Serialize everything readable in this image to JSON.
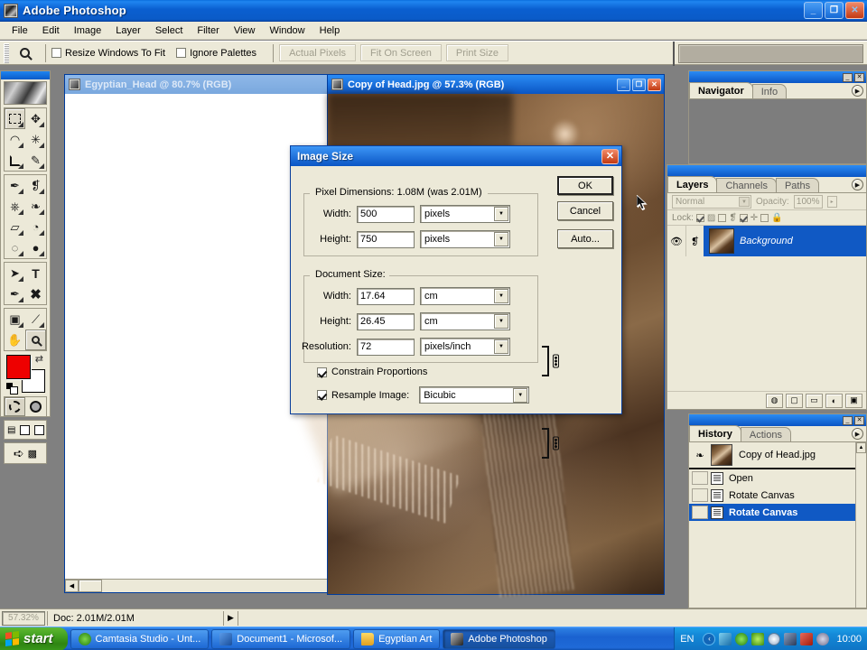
{
  "window": {
    "title": "Adobe Photoshop",
    "minimize_label": "_",
    "restore_label": "❐",
    "close_label": "✕"
  },
  "menubar": {
    "items": [
      {
        "label": "File"
      },
      {
        "label": "Edit"
      },
      {
        "label": "Image"
      },
      {
        "label": "Layer"
      },
      {
        "label": "Select"
      },
      {
        "label": "Filter"
      },
      {
        "label": "View"
      },
      {
        "label": "Window"
      },
      {
        "label": "Help"
      }
    ]
  },
  "options_bar": {
    "active_tool_icon": "zoom-magnifier-icon",
    "checkboxes": [
      {
        "label": "Resize Windows To Fit",
        "checked": false
      },
      {
        "label": "Ignore Palettes",
        "checked": false
      }
    ],
    "buttons": [
      {
        "label": "Actual Pixels",
        "disabled": true
      },
      {
        "label": "Fit On Screen",
        "disabled": true
      },
      {
        "label": "Print Size",
        "disabled": true
      }
    ]
  },
  "toolbox": {
    "tools": [
      {
        "name": "rectangular-marquee-tool",
        "glyph": ""
      },
      {
        "name": "move-tool",
        "glyph": "➤"
      },
      {
        "name": "lasso-tool",
        "glyph": "◠"
      },
      {
        "name": "magic-wand-tool",
        "glyph": "✳"
      },
      {
        "name": "crop-tool",
        "glyph": ""
      },
      {
        "name": "slice-tool",
        "glyph": "✎"
      },
      {
        "name": "healing-brush-tool",
        "glyph": "✒"
      },
      {
        "name": "brush-tool",
        "glyph": "🖌"
      },
      {
        "name": "clone-stamp-tool",
        "glyph": "⎈"
      },
      {
        "name": "history-brush-tool",
        "glyph": "✍"
      },
      {
        "name": "eraser-tool",
        "glyph": "▱"
      },
      {
        "name": "paint-bucket-tool",
        "glyph": "◔"
      },
      {
        "name": "blur-tool",
        "glyph": "◍"
      },
      {
        "name": "dodge-tool",
        "glyph": "●"
      },
      {
        "name": "path-selection-tool",
        "glyph": "➤"
      },
      {
        "name": "type-tool",
        "glyph": "T"
      },
      {
        "name": "pen-tool",
        "glyph": "✒"
      },
      {
        "name": "custom-shape-tool",
        "glyph": "✖"
      },
      {
        "name": "notes-tool",
        "glyph": "▣"
      },
      {
        "name": "eyedropper-tool",
        "glyph": "⟋"
      },
      {
        "name": "hand-tool",
        "glyph": "✋"
      },
      {
        "name": "zoom-tool",
        "glyph": "🔍"
      }
    ],
    "foreground_color": "#EE0000",
    "background_color": "#FFFFFF",
    "mode_buttons": [
      "standard-mask-mode",
      "quick-mask-mode"
    ],
    "screen_modes": [
      "standard-screen-mode",
      "full-screen-with-menubar",
      "full-screen-mode"
    ],
    "jump_to_label": "jump-to-imageready"
  },
  "documents": [
    {
      "title": "Egyptian_Head @ 80.7% (RGB)",
      "active": false,
      "canvas_background": "#FFFFFF"
    },
    {
      "title": "Copy of Head.jpg @ 57.3% (RGB)",
      "active": true,
      "minimize_label": "_",
      "maximize_label": "❐",
      "close_label": "✕"
    }
  ],
  "palettes": {
    "navigator": {
      "tabs": [
        {
          "label": "Navigator",
          "active": true
        },
        {
          "label": "Info",
          "active": false
        }
      ],
      "minimize_label": "_",
      "close_label": "✕",
      "menu_label": "▶"
    },
    "layers": {
      "tabs": [
        {
          "label": "Layers",
          "active": true
        },
        {
          "label": "Channels",
          "active": false
        },
        {
          "label": "Paths",
          "active": false
        }
      ],
      "blend_mode": "Normal",
      "opacity_label": "Opacity:",
      "opacity_value": "100%",
      "lock_label": "Lock:",
      "lock_items": [
        {
          "name": "lock-transparent-pixels",
          "checked": true,
          "glyph": "▨"
        },
        {
          "name": "lock-image-pixels",
          "checked": false,
          "glyph": "🖌"
        },
        {
          "name": "lock-position",
          "checked": true,
          "glyph": "✛"
        },
        {
          "name": "lock-all",
          "checked": false,
          "glyph": "🔒"
        }
      ],
      "layer_items": [
        {
          "name": "Background",
          "visible": true,
          "locked": true,
          "selected": true
        }
      ],
      "bottom_buttons": [
        {
          "name": "layer-style-button",
          "glyph": "◍"
        },
        {
          "name": "layer-mask-button",
          "glyph": "▢"
        },
        {
          "name": "new-group-button",
          "glyph": "▭"
        },
        {
          "name": "adjustment-layer-button",
          "glyph": "◐"
        },
        {
          "name": "new-layer-button",
          "glyph": "▣"
        },
        {
          "name": "delete-layer-button",
          "glyph": "🗑"
        }
      ],
      "menu_label": "▶"
    },
    "history": {
      "tabs": [
        {
          "label": "History",
          "active": true
        },
        {
          "label": "Actions",
          "active": false
        }
      ],
      "snapshot": "Copy of Head.jpg",
      "states": [
        {
          "label": "Open",
          "selected": false
        },
        {
          "label": "Rotate Canvas",
          "selected": false
        },
        {
          "label": "Rotate Canvas",
          "selected": true
        }
      ],
      "menu_label": "▶",
      "minimize_label": "_",
      "close_label": "✕"
    }
  },
  "dialog": {
    "title": "Image Size",
    "close_label": "✕",
    "pixel_dimensions": {
      "legend": "Pixel Dimensions:  1.08M (was 2.01M)",
      "size_current": "1.08M",
      "size_previous": "2.01M",
      "width_label": "Width:",
      "width_value": "500",
      "width_unit": "pixels",
      "height_label": "Height:",
      "height_value": "750",
      "height_unit": "pixels"
    },
    "document_size": {
      "legend": "Document Size:",
      "width_label": "Width:",
      "width_value": "17.64",
      "width_unit": "cm",
      "height_label": "Height:",
      "height_value": "26.45",
      "height_unit": "cm",
      "resolution_label": "Resolution:",
      "resolution_value": "72",
      "resolution_unit": "pixels/inch"
    },
    "constrain_proportions": {
      "label": "Constrain Proportions",
      "checked": true
    },
    "resample_image": {
      "label": "Resample Image:",
      "checked": true,
      "value": "Bicubic"
    },
    "buttons": [
      {
        "label": "OK",
        "default": true
      },
      {
        "label": "Cancel",
        "default": false
      },
      {
        "label": "Auto...",
        "default": false
      }
    ]
  },
  "status_bar": {
    "zoom": "57.32%",
    "doc_info": "Doc: 2.01M/2.01M",
    "expand_label": "▶"
  },
  "taskbar": {
    "start_label": "start",
    "items": [
      {
        "label": "Camtasia Studio - Unt...",
        "icon_color": "#3aa83a",
        "active": false
      },
      {
        "label": "Document1 - Microsof...",
        "icon_color": "#2a5fb8",
        "active": false
      },
      {
        "label": "Egyptian Art",
        "icon_color": "#f5c542",
        "active": false
      },
      {
        "label": "Adobe Photoshop",
        "icon_color": "#33333a",
        "active": true
      }
    ],
    "language": "EN",
    "tray_icons": [
      {
        "name": "network-icon",
        "color": "#3aa0d8"
      },
      {
        "name": "camtasia-tray-icon",
        "color": "#2fa82f"
      },
      {
        "name": "nvidia-icon",
        "color": "#5fc82f"
      },
      {
        "name": "antivirus-icon",
        "color": "#d8d8e8"
      },
      {
        "name": "monitor-icon",
        "color": "#5a6a8a"
      },
      {
        "name": "network-disconnected-icon",
        "color": "#c83a2a"
      },
      {
        "name": "volume-icon",
        "color": "#8a8a9a"
      }
    ],
    "clock": "10:00",
    "show_hidden_label": "‹"
  }
}
